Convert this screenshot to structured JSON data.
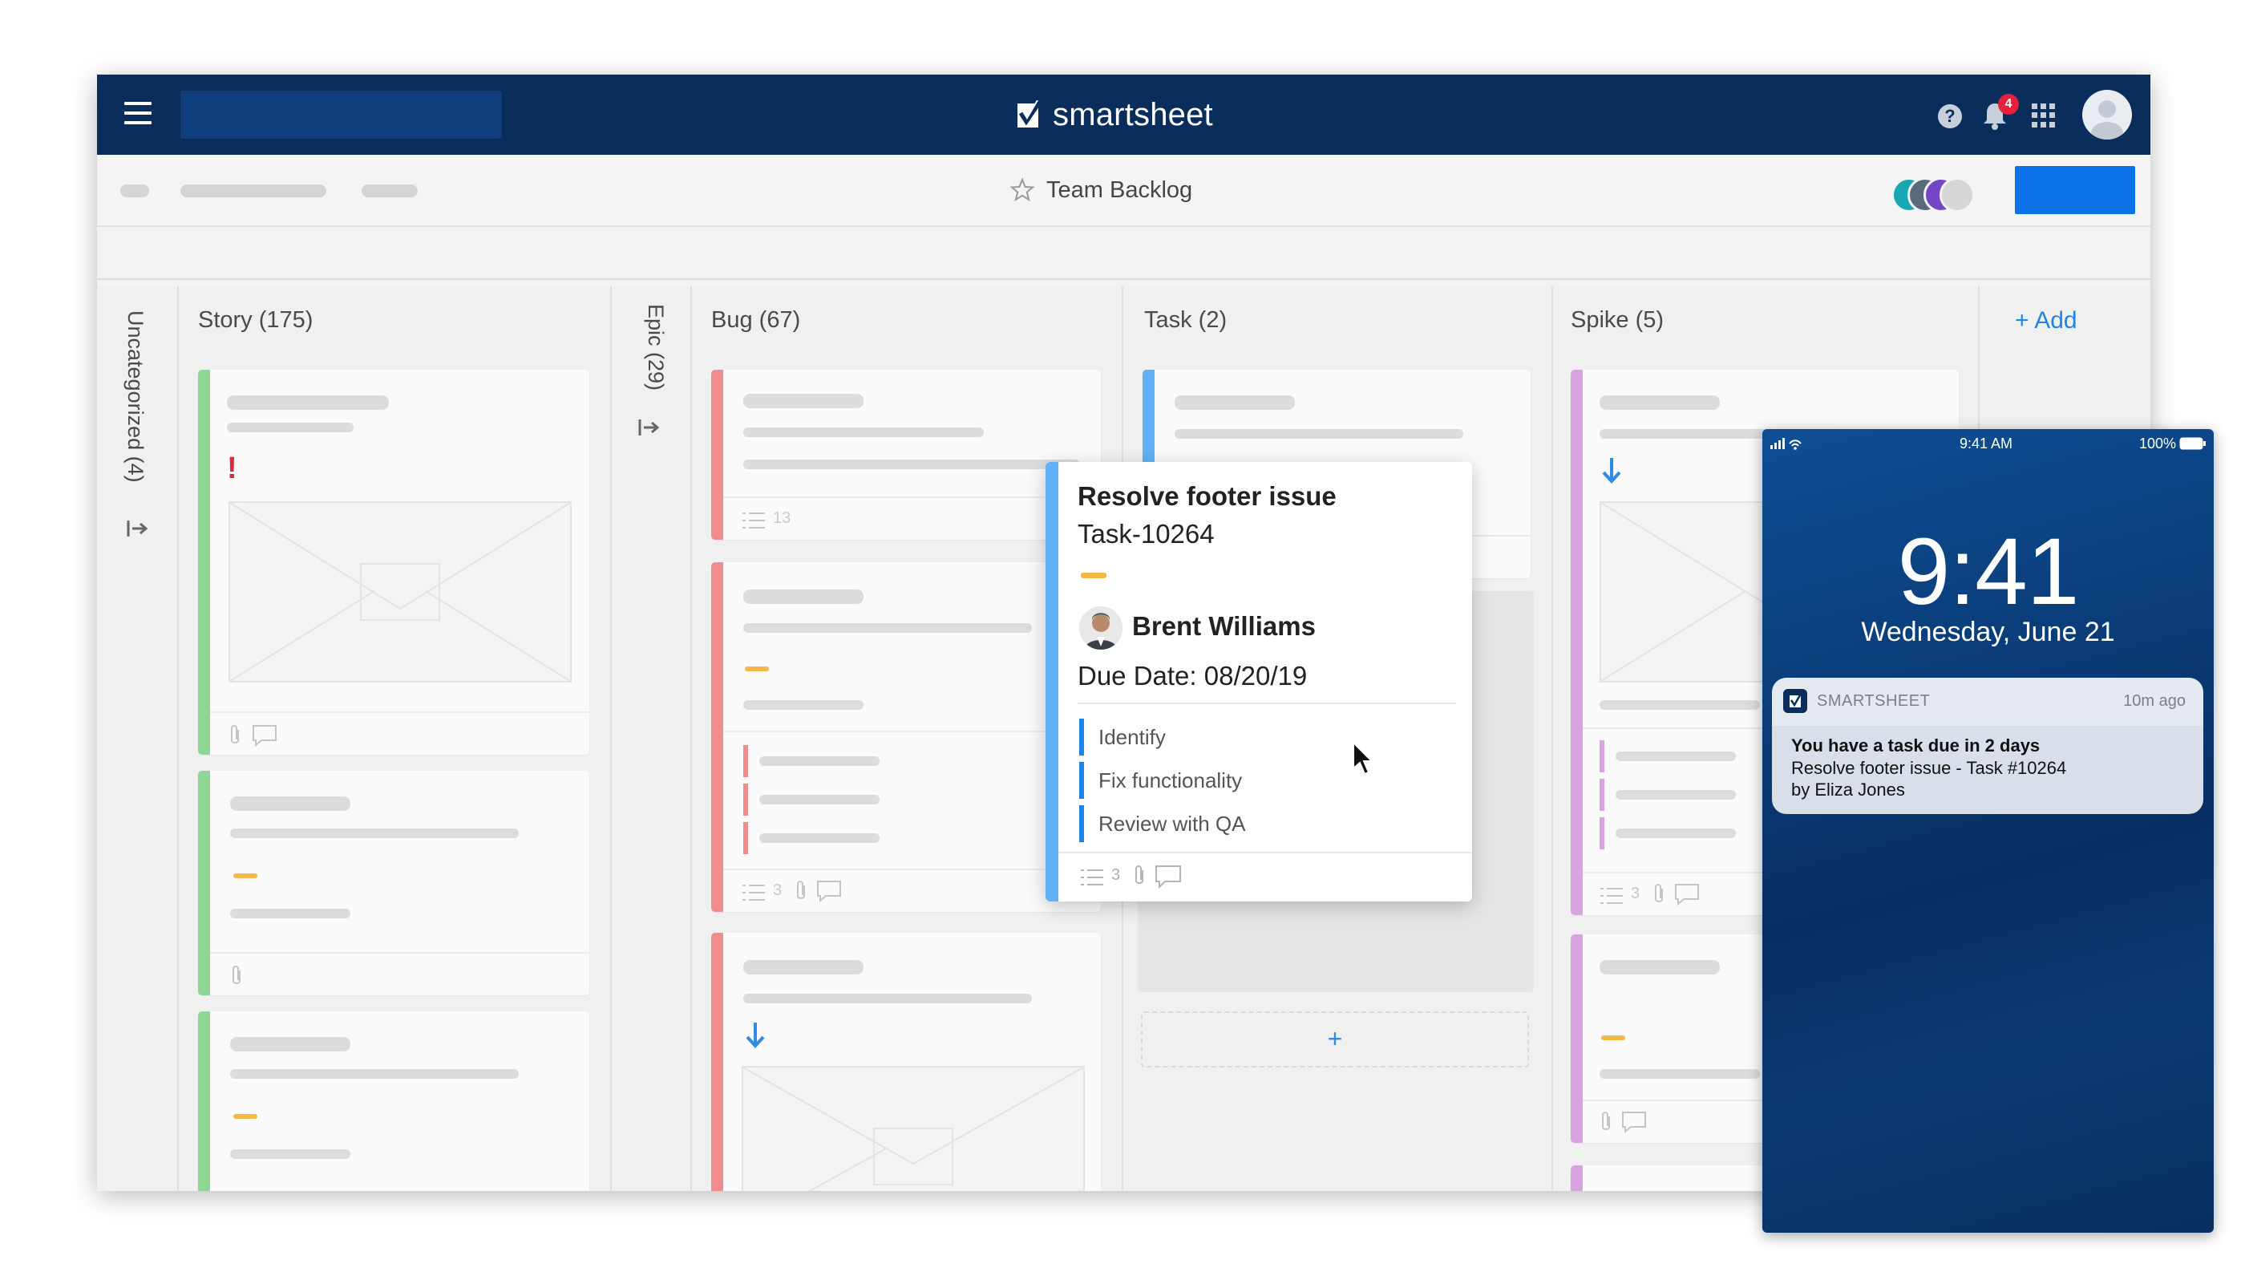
{
  "header": {
    "brand": "smartsheet",
    "notification_count": "4"
  },
  "subbar": {
    "sheet_title": "Team Backlog"
  },
  "lanes": {
    "uncategorized": "Uncategorized (4)",
    "story": "Story (175)",
    "epic": "Epic (29)",
    "bug": "Bug (67)",
    "task": "Task (2)",
    "spike": "Spike (5)",
    "add": "+ Add"
  },
  "cards": {
    "bug_card_1_subtask_count": "13",
    "bug_card_2_subtask_count": "3",
    "spike_card_2_subtask_count": "3",
    "popup_subtask_count": "3",
    "task_add": "+"
  },
  "popup": {
    "title": "Resolve footer issue",
    "id": "Task-10264",
    "assignee": "Brent Williams",
    "due": "Due Date: 08/20/19",
    "subtasks": [
      "Identify",
      "Fix functionality",
      "Review with QA"
    ]
  },
  "phone": {
    "status_time": "9:41 AM",
    "battery": "100%",
    "clock": "9:41",
    "date": "Wednesday, June 21",
    "notification": {
      "app": "SMARTSHEET",
      "ago": "10m ago",
      "line1": "You have a task due in 2 days",
      "line2": "Resolve footer issue - Task #10264",
      "line3": "by Eliza Jones"
    }
  },
  "colors": {
    "topbar": "#0a2d5c",
    "accent": "#0b72e7",
    "story": "#8fd694",
    "bug": "#f18c8c",
    "task": "#5fb2f6",
    "spike": "#d9a2e0",
    "priority_medium": "#f5b746",
    "priority_high": "#e2263a"
  },
  "icons": [
    "menu-icon",
    "smartsheet-logo-icon",
    "help-icon",
    "bell-icon",
    "apps-grid-icon",
    "user-avatar-icon",
    "star-icon",
    "attachment-icon",
    "comment-icon",
    "checklist-icon",
    "arrow-down-icon",
    "collapse-lane-icon",
    "cursor-icon"
  ]
}
